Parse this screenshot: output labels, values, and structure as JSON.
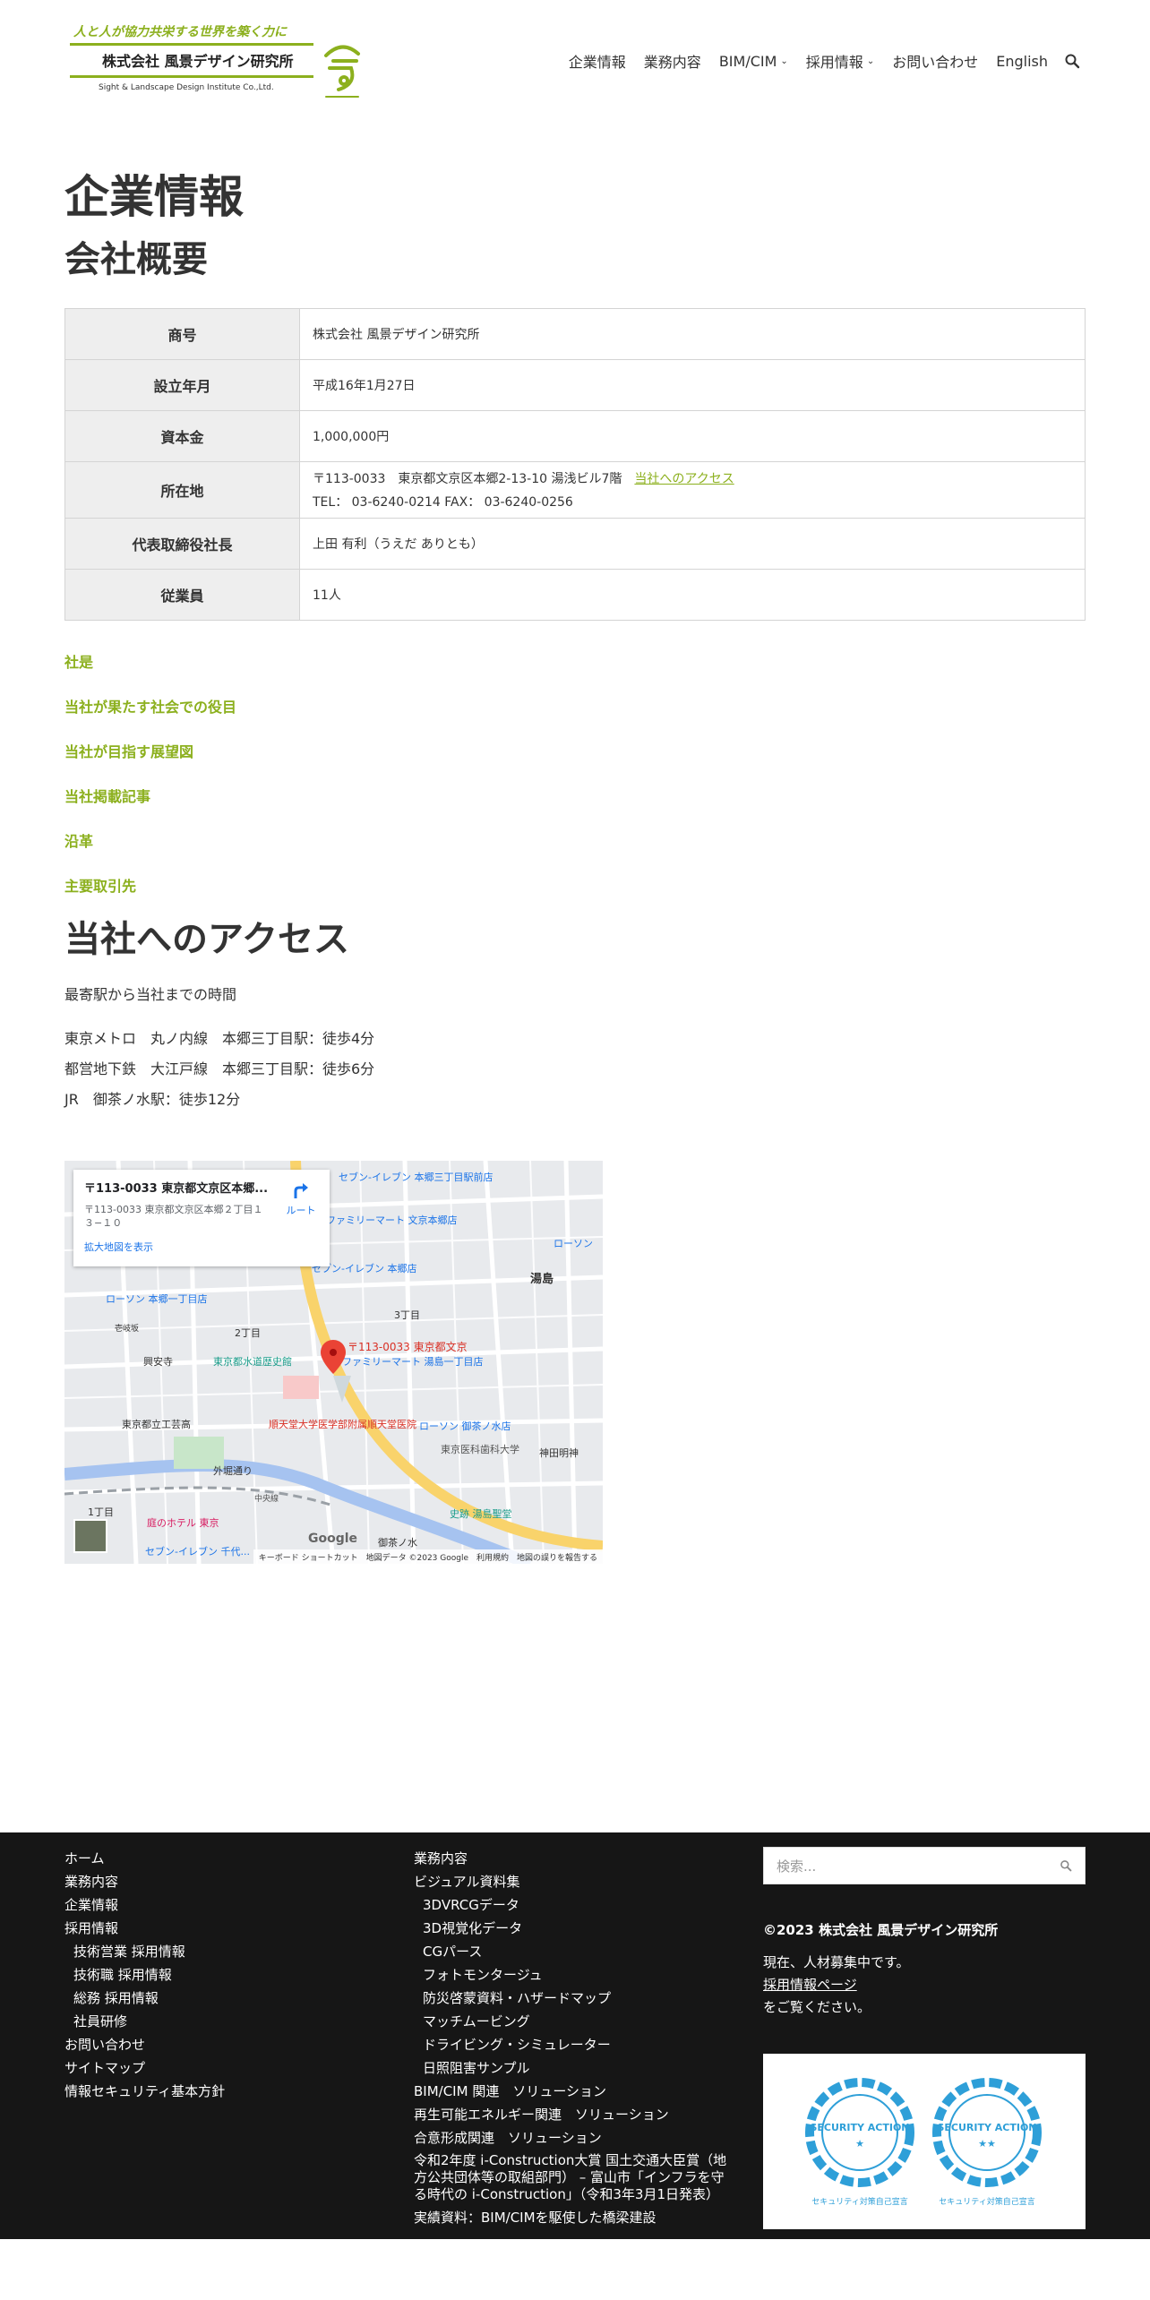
{
  "header": {
    "logo": {
      "tagline": "人と人が協力共栄する世界を築く力に",
      "company": "株式会社 風景デザイン研究所",
      "company_en": "Sight & Landscape Design Institute Co.,Ltd.",
      "brand_color": "#8cb01e"
    },
    "nav": [
      {
        "label": "企業情報",
        "has_dropdown": false
      },
      {
        "label": "業務内容",
        "has_dropdown": false
      },
      {
        "label": "BIM/CIM",
        "has_dropdown": true
      },
      {
        "label": "採用情報",
        "has_dropdown": true
      },
      {
        "label": "お問い合わせ",
        "has_dropdown": false
      },
      {
        "label": "English",
        "has_dropdown": false
      }
    ],
    "search_icon": "search-icon"
  },
  "page": {
    "title": "企業情報",
    "section_title": "会社概要",
    "overview": [
      {
        "label": "商号",
        "value": "株式会社 風景デザイン研究所"
      },
      {
        "label": "設立年月",
        "value": "平成16年1月27日"
      },
      {
        "label": "資本金",
        "value": "1,000,000円"
      },
      {
        "label": "所在地",
        "value": "〒113-0033　東京都文京区本郷2-13-10 湯浅ビル7階",
        "link": "当社へのアクセス",
        "value2": "TEL：  03-6240-0214  FAX：  03-6240-0256"
      },
      {
        "label": "代表取締役社長",
        "value": "上田 有利（うえだ ありとも）"
      },
      {
        "label": "従業員",
        "value": "11人"
      }
    ],
    "section_links": [
      "社是",
      "当社が果たす社会での役目",
      "当社が目指す展望図",
      "当社掲載記事",
      "沿革",
      "主要取引先"
    ],
    "access_title": "当社へのアクセス",
    "access_intro": "最寄駅から当社までの時間",
    "access_lines": [
      "東京メトロ　丸ノ内線　本郷三丁目駅：徒歩4分",
      "都営地下鉄　大江戸線　本郷三丁目駅：徒歩6分",
      "JR　御茶ノ水駅：徒歩12分"
    ],
    "map": {
      "card_title": "〒113-0033 東京都文京区本郷...",
      "card_address": "〒113-0033 東京都文京区本郷２丁目１３−１０",
      "card_link": "拡大地図を表示",
      "route_label": "ルート",
      "pin_label": "〒113-0033 東京都文京",
      "google_label": "Google",
      "footer_text": "キーボード ショートカット　地図データ ©2023 Google　利用規約　地図の誤りを報告する",
      "labels": [
        {
          "text": "セブン-イレブン 本郷三丁目駅前店"
        },
        {
          "text": "ファミリーマート 文京本郷店"
        },
        {
          "text": "ローソン"
        },
        {
          "text": "セブン-イレブン 本郷店"
        },
        {
          "text": "湯島"
        },
        {
          "text": "ローソン 本郷一丁目店"
        },
        {
          "text": "壱岐坂"
        },
        {
          "text": "2丁目"
        },
        {
          "text": "3丁目"
        },
        {
          "text": "興安寺"
        },
        {
          "text": "東京都水道歴史館"
        },
        {
          "text": "ファミリーマート 湯島一丁目店"
        },
        {
          "text": "順天堂大学医学部附属順天堂医院"
        },
        {
          "text": "ローソン 御茶ノ水店"
        },
        {
          "text": "東京都立工芸高"
        },
        {
          "text": "東京医科歯科大学"
        },
        {
          "text": "神田明神"
        },
        {
          "text": "外堀通り"
        },
        {
          "text": "中央線"
        },
        {
          "text": "史跡 湯島聖堂"
        },
        {
          "text": "庭のホテル 東京"
        },
        {
          "text": "1丁目"
        },
        {
          "text": "御茶ノ水"
        },
        {
          "text": "セブン-イレブン 千代..."
        }
      ]
    }
  },
  "footer": {
    "col1": [
      {
        "label": "ホーム",
        "sub": false
      },
      {
        "label": "業務内容",
        "sub": false
      },
      {
        "label": "企業情報",
        "sub": false
      },
      {
        "label": "採用情報",
        "sub": false
      },
      {
        "label": "技術営業 採用情報",
        "sub": true
      },
      {
        "label": "技術職 採用情報",
        "sub": true
      },
      {
        "label": "総務 採用情報",
        "sub": true
      },
      {
        "label": "社員研修",
        "sub": true
      },
      {
        "label": "お問い合わせ",
        "sub": false
      },
      {
        "label": "サイトマップ",
        "sub": false
      },
      {
        "label": "情報セキュリティ基本方針",
        "sub": false
      }
    ],
    "col2": [
      {
        "label": "業務内容",
        "sub": false
      },
      {
        "label": "ビジュアル資料集",
        "sub": false
      },
      {
        "label": "3DVRCGデータ",
        "sub": true
      },
      {
        "label": "3D視覚化データ",
        "sub": true
      },
      {
        "label": "CGパース",
        "sub": true
      },
      {
        "label": "フォトモンタージュ",
        "sub": true
      },
      {
        "label": "防災啓蒙資料・ハザードマップ",
        "sub": true
      },
      {
        "label": "マッチムービング",
        "sub": true
      },
      {
        "label": "ドライビング・シミュレーター",
        "sub": true
      },
      {
        "label": "日照阻害サンプル",
        "sub": true
      },
      {
        "label": "BIM/CIM 関連　ソリューション",
        "sub": false
      },
      {
        "label": "再生可能エネルギー関連　ソリューション",
        "sub": false
      },
      {
        "label": "合意形成関連　ソリューション",
        "sub": false
      },
      {
        "label": "令和2年度 i-Construction大賞 国土交通大臣賞（地方公共団体等の取組部門） – 富山市「インフラを守る時代の i-Construction」（令和3年3月1日発表）",
        "sub": false,
        "wrap": true
      },
      {
        "label": "実績資料：BIM/CIMを駆使した橋梁建設",
        "sub": false
      }
    ],
    "search_placeholder": "検索...",
    "copyright": "©2023 株式会社 風景デザイン研究所",
    "recruit_msg_pre": "現在、人材募集中です。",
    "recruit_link": "採用情報ページ",
    "recruit_msg_post": "をご覧ください。",
    "badges": [
      {
        "title": "SECURITY ACTION",
        "stars": "★",
        "caption": "セキュリティ対策自己宣言"
      },
      {
        "title": "SECURITY ACTION",
        "stars": "★★",
        "caption": "セキュリティ対策自己宣言"
      }
    ],
    "badge_color": "#2e9fd8"
  }
}
